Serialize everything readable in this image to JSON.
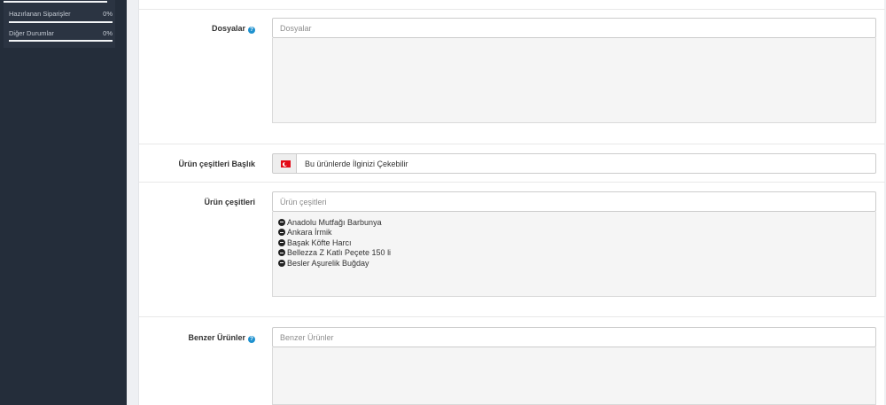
{
  "sidebar": {
    "stats": [
      {
        "label": "Hazırlanan Siparişler",
        "percent": "0%"
      },
      {
        "label": "Diğer Durumlar",
        "percent": "0%"
      }
    ]
  },
  "form": {
    "files": {
      "label": "Dosyalar",
      "placeholder": "Dosyalar",
      "value": ""
    },
    "variants_title": {
      "label": "Ürün çeşitleri Başlık",
      "value": "Bu ürünlerde İlginizi Çekebilir",
      "language": "Türkçe"
    },
    "variants": {
      "label": "Ürün çeşitleri",
      "placeholder": "Ürün çeşitleri",
      "value": "",
      "items": [
        "Anadolu Mutfağı Barbunya",
        "Ankara İrmik",
        "Başak Köfte Harcı",
        "Bellezza Z Katlı Peçete 150 li",
        "Besler Aşurelik Buğday"
      ]
    },
    "related": {
      "label": "Benzer Ürünler",
      "placeholder": "Benzer Ürünler",
      "value": ""
    }
  },
  "colors": {
    "sidebar_bg": "#242d3a",
    "help_icon": "#1e91cf",
    "flag_red": "#e30a17"
  }
}
